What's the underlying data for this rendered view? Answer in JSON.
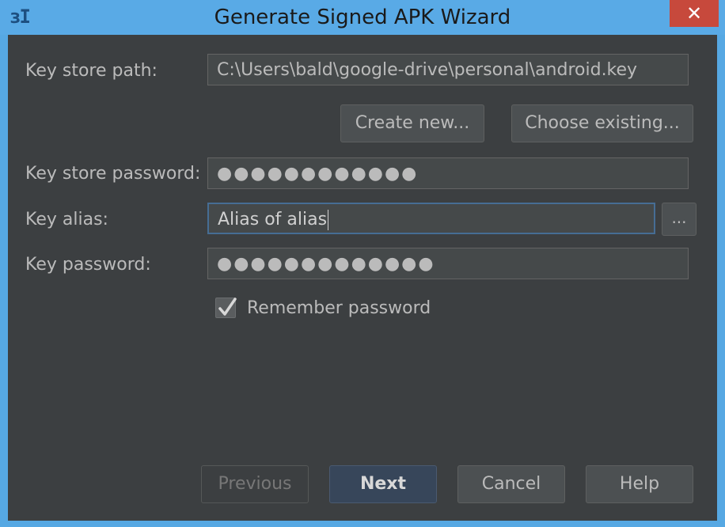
{
  "window": {
    "title": "Generate Signed APK Wizard",
    "app_icon": "intellij-icon",
    "app_icon_glyph": "зI",
    "close_glyph": "✕"
  },
  "form": {
    "keystore_path_label": "Key store path:",
    "keystore_path_value": "C:\\Users\\bald\\google-drive\\personal\\android.key",
    "create_new_label": "Create new...",
    "choose_existing_label": "Choose existing...",
    "keystore_password_label": "Key store password:",
    "keystore_password_value": "●●●●●●●●●●●●",
    "key_alias_label": "Key alias:",
    "key_alias_value": "Alias of alias",
    "browse_alias_label": "...",
    "key_password_label": "Key password:",
    "key_password_value": "●●●●●●●●●●●●●",
    "remember_password_label": "Remember password",
    "remember_password_checked": true
  },
  "footer": {
    "previous_label": "Previous",
    "next_label": "Next",
    "cancel_label": "Cancel",
    "help_label": "Help"
  },
  "colors": {
    "titlebar": "#59aae6",
    "dialog_bg": "#3c3f41",
    "close_red": "#c7493c",
    "focus_border": "#466d94"
  }
}
